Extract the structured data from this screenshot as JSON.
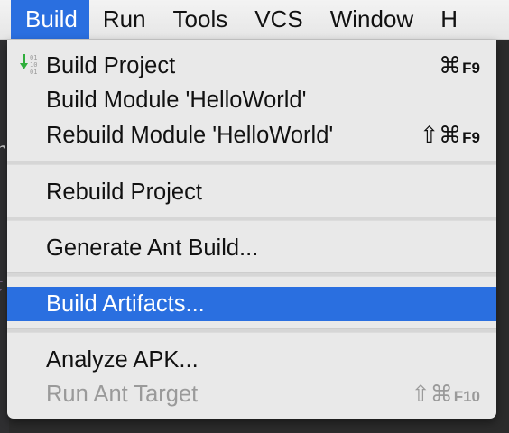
{
  "menubar": {
    "items": [
      {
        "label": "Build"
      },
      {
        "label": "Run"
      },
      {
        "label": "Tools"
      },
      {
        "label": "VCS"
      },
      {
        "label": "Window"
      },
      {
        "label": "H"
      }
    ]
  },
  "dropdown": {
    "build_project": {
      "label": "Build Project",
      "symbol": "⌘",
      "fkey": "F9",
      "icon": "build-project-icon"
    },
    "build_module": {
      "label": "Build Module 'HelloWorld'"
    },
    "rebuild_module": {
      "label": "Rebuild Module 'HelloWorld'",
      "symbol": "⇧⌘",
      "fkey": "F9"
    },
    "rebuild_project": {
      "label": "Rebuild Project"
    },
    "generate_ant": {
      "label": "Generate Ant Build..."
    },
    "build_artifacts": {
      "label": "Build Artifacts..."
    },
    "analyze_apk": {
      "label": "Analyze APK..."
    },
    "run_ant_target": {
      "label": "Run Ant Target",
      "symbol": "⇧⌘",
      "fkey": "F10"
    }
  },
  "colors": {
    "highlight": "#2a6fe0",
    "menu_bg": "#e9e9e9",
    "disabled_text": "#9a9a9a",
    "icon_green": "#2fae3c"
  }
}
